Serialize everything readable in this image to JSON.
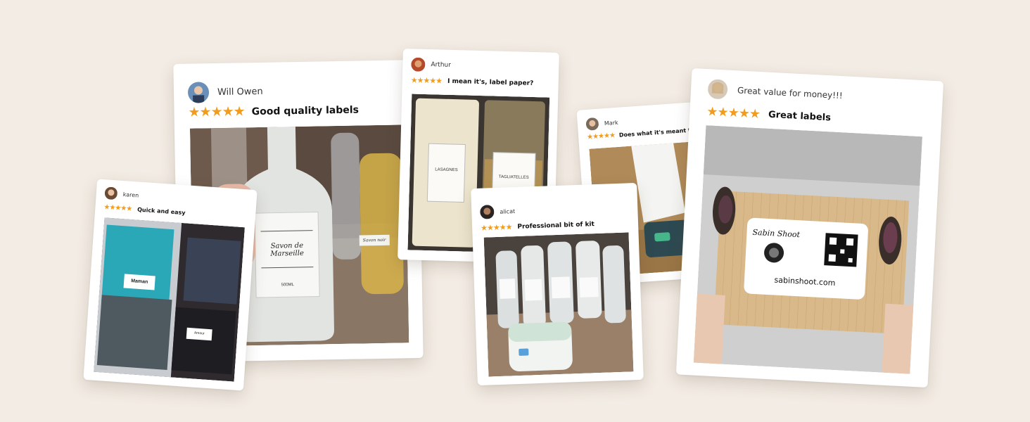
{
  "colors": {
    "background": "#f3ece4",
    "star": "#f39c1c",
    "card": "#ffffff"
  },
  "reviews": {
    "will": {
      "user": "Will Owen",
      "stars": "★★★★★",
      "title": "Good quality labels",
      "photo": {
        "label_text": "Savon de Marseille",
        "volume": "500ML",
        "label_right": "Savon noir"
      }
    },
    "karen": {
      "user": "karen",
      "stars": "★★★★★",
      "title": "Quick and easy",
      "photo": {
        "label_1": "Maman",
        "label_2": "Amour"
      }
    },
    "arthur": {
      "user": "Arthur",
      "stars": "★★★★★",
      "title": "I mean it's, label paper?",
      "photo": {
        "label_1": "LASAGNES",
        "label_2": "TAGLIATELLES"
      }
    },
    "alicat": {
      "user": "alicat",
      "stars": "★★★★★",
      "title": "Professional bit of kit"
    },
    "mark": {
      "user": "Mark",
      "stars": "★★★★★",
      "title": "Does what it's meant to"
    },
    "great": {
      "user": "Great value for money!!!",
      "stars": "★★★★★",
      "title": "Great labels",
      "photo": {
        "logo_text": "Sabin Shoot",
        "website": "sabinshoot.com"
      }
    }
  }
}
